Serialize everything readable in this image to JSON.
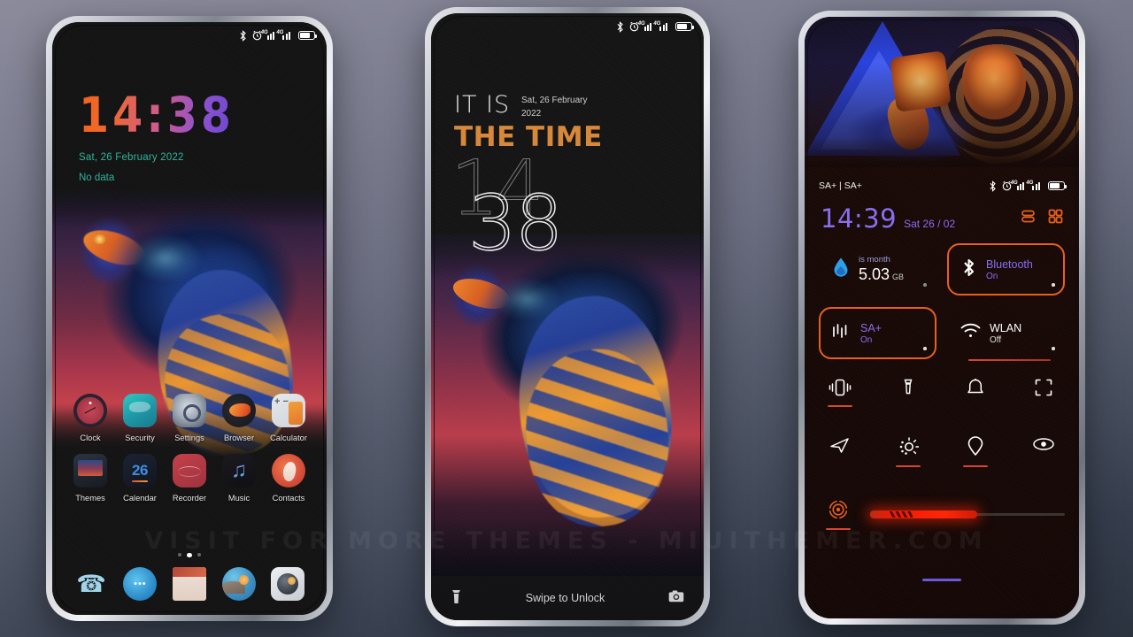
{
  "watermark": "VISIT  FOR  MORE  THEMES  -  MIUITHEMER.COM",
  "phone1": {
    "name": "home-screen",
    "statusbar": {
      "bluetooth": "bluetooth-icon",
      "alarm": "alarm-icon",
      "network1": "4G",
      "network2": "4G",
      "battery": "battery-icon"
    },
    "clock_widget": {
      "time": "14:38",
      "date": "Sat, 26 February 2022",
      "weather": "No data"
    },
    "apps_row1": [
      {
        "label": "Clock",
        "icon": "clock-app-icon"
      },
      {
        "label": "Security",
        "icon": "security-app-icon"
      },
      {
        "label": "Settings",
        "icon": "settings-app-icon"
      },
      {
        "label": "Browser",
        "icon": "browser-app-icon"
      },
      {
        "label": "Calculator",
        "icon": "calculator-app-icon"
      }
    ],
    "apps_row2": [
      {
        "label": "Themes",
        "icon": "themes-app-icon"
      },
      {
        "label": "Calendar",
        "icon": "calendar-app-icon",
        "day": "26"
      },
      {
        "label": "Recorder",
        "icon": "recorder-app-icon"
      },
      {
        "label": "Music",
        "icon": "music-app-icon"
      },
      {
        "label": "Contacts",
        "icon": "contacts-app-icon"
      }
    ],
    "page_dots": {
      "count": 3,
      "active_index": 1
    },
    "dock": [
      {
        "icon": "phone-app-icon"
      },
      {
        "icon": "messages-app-icon"
      },
      {
        "icon": "notes-app-icon"
      },
      {
        "icon": "gallery-app-icon"
      },
      {
        "icon": "camera-app-icon"
      }
    ]
  },
  "phone2": {
    "name": "lock-screen",
    "statusbar": {
      "network1": "4G",
      "network2": "4G"
    },
    "it_is": "IT IS",
    "the_time": "THE TIME",
    "date_line1": "Sat, 26 February",
    "date_line2": "2022",
    "hour": "14",
    "minute": "38",
    "unlock_hint": "Swipe to Unlock",
    "left_icon": "flashlight-icon",
    "right_icon": "camera-icon"
  },
  "phone3": {
    "name": "control-center",
    "carrier": "SA+ | SA+",
    "statusbar": {
      "network1": "4G",
      "network2": "4G"
    },
    "time": "14:39",
    "date": "Sat 26 / 02",
    "header_icons": [
      "list-view-icon",
      "grid-view-icon"
    ],
    "tiles": [
      {
        "name": "data-usage-tile",
        "title": "is month",
        "value": "5.03",
        "unit": "GB",
        "icon": "data-drop-icon",
        "active": false
      },
      {
        "name": "bluetooth-tile",
        "title": "Bluetooth",
        "state": "On",
        "icon": "bluetooth-icon",
        "active": true
      },
      {
        "name": "sa-plus-tile",
        "title": "SA+",
        "state": "On",
        "icon": "signal-bars-icon",
        "active": true
      },
      {
        "name": "wlan-tile",
        "title": "WLAN",
        "state": "Off",
        "icon": "wifi-icon",
        "active": false
      }
    ],
    "quick_row1": [
      {
        "name": "vibrate-toggle",
        "icon": "vibrate-icon",
        "on": true
      },
      {
        "name": "flashlight-toggle",
        "icon": "flashlight-icon",
        "on": false
      },
      {
        "name": "ringer-toggle",
        "icon": "bell-icon",
        "on": false
      },
      {
        "name": "screenshot-toggle",
        "icon": "screenshot-icon",
        "on": false
      }
    ],
    "quick_row2": [
      {
        "name": "airplane-toggle",
        "icon": "send-plane-icon",
        "on": false
      },
      {
        "name": "auto-brightness-toggle",
        "icon": "brightness-auto-icon",
        "on": true
      },
      {
        "name": "location-toggle",
        "icon": "location-pin-icon",
        "on": true
      },
      {
        "name": "eye-care-toggle",
        "icon": "eye-icon",
        "on": false
      }
    ],
    "brightness": {
      "icon": "target-icon",
      "icon_on": true,
      "percent": 55
    }
  },
  "colors": {
    "accent_orange": "#e8601b",
    "accent_purple": "#8a6ef0",
    "teal": "#2fb39a",
    "slider_red": "#ff2608",
    "lock_orange": "#d8883a"
  }
}
